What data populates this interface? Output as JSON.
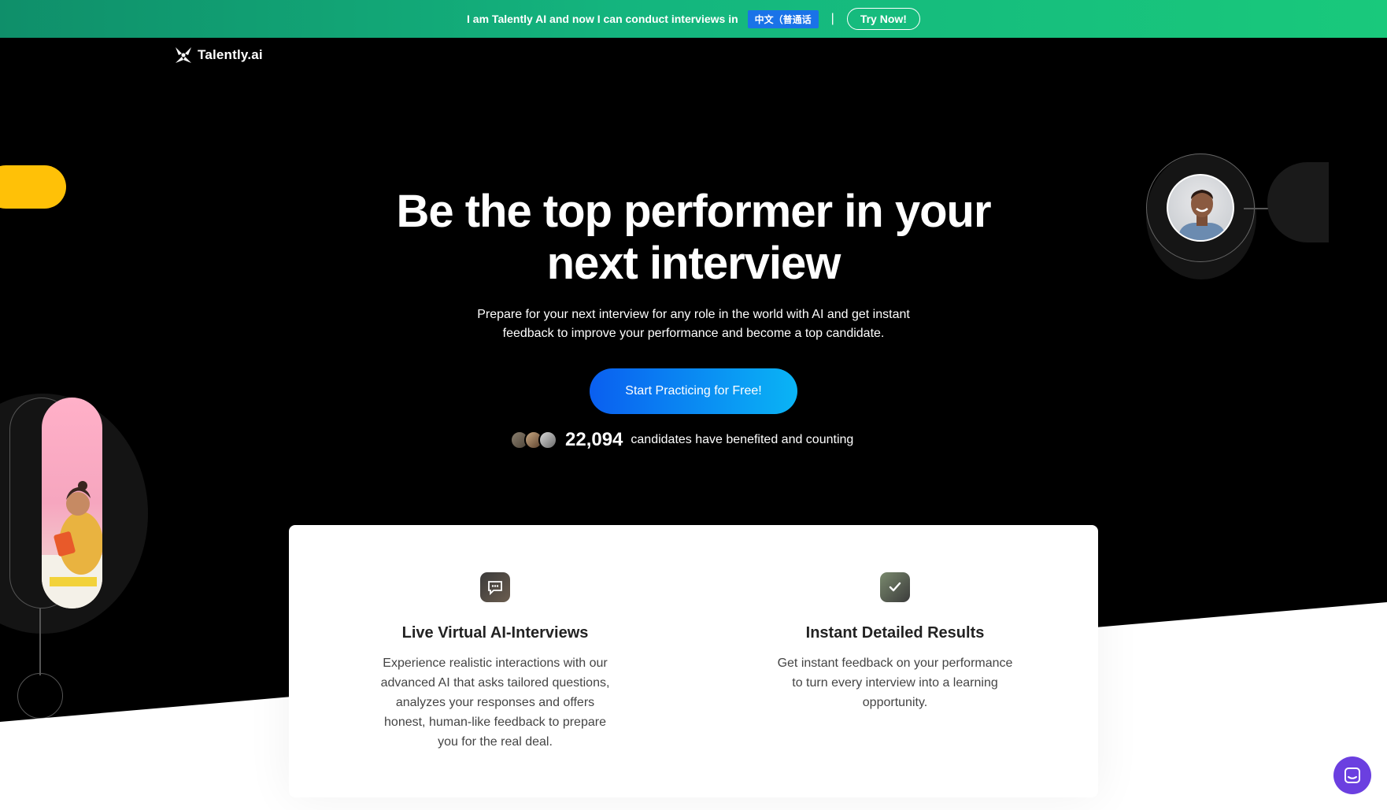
{
  "banner": {
    "text": "I am Talently AI and now I can conduct interviews in",
    "language": "中文（普通话",
    "separator": "|",
    "try_label": "Try Now!"
  },
  "logo": {
    "text": "Talently.ai"
  },
  "hero": {
    "title_line1": "Be the top performer in your",
    "title_line2": "next interview",
    "subtitle_line1": "Prepare for your next interview for any role in the world with AI and get instant",
    "subtitle_line2": "feedback to improve your performance and become a top candidate.",
    "cta_label": "Start Practicing for Free!",
    "stats_count": "22,094",
    "stats_label": "candidates have benefited and counting"
  },
  "features": [
    {
      "title": "Live Virtual AI-Interviews",
      "description": "Experience realistic interactions with our advanced AI that asks tailored questions, analyzes your responses and offers honest, human-like feedback to prepare you for the real deal.",
      "icon": "speech-bubble-icon"
    },
    {
      "title": "Instant Detailed Results",
      "description": "Get instant feedback on your performance to turn every interview into a learning opportunity.",
      "icon": "checklist-icon"
    }
  ],
  "colors": {
    "banner_green": "#14b57e",
    "cta_blue": "#0a5ff0",
    "cta_cyan": "#0ab4f5",
    "accent_yellow": "#ffc107",
    "chat_purple": "#6b3fe0"
  },
  "chat": {
    "icon": "chat-icon"
  }
}
